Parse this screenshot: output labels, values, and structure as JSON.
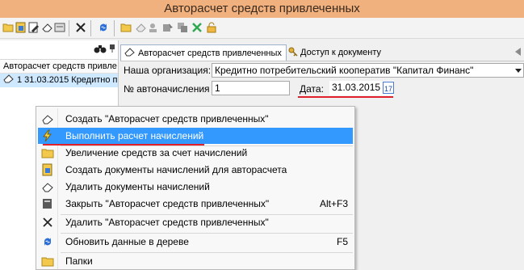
{
  "window": {
    "title": "Авторасчет средств привлеченных"
  },
  "left_panel": {
    "column_header": "Авторасчет средств привле",
    "row_label": "1 31.03.2015 Кредитно п"
  },
  "tabs": [
    {
      "label": "Авторасчет средств привлеченных"
    },
    {
      "label": "Доступ к документу"
    }
  ],
  "form": {
    "org_label": "Наша организация:",
    "org_value": "Кредитно потребительский кооператив \"Капитал Финанс\"",
    "num_label": "№ автоначисления",
    "num_value": "1",
    "date_label": "Дата:",
    "date_value": "31.03.2015",
    "calendar_day": "17"
  },
  "menu": {
    "items": [
      {
        "label": "Создать \"Авторасчет средств привлеченных\"",
        "shortcut": ""
      },
      {
        "label": "Выполнить расчет начислений",
        "shortcut": ""
      },
      {
        "label": "Увеличение средств за счет начислений",
        "shortcut": ""
      },
      {
        "label": "Создать документы начислений для авторасчета",
        "shortcut": ""
      },
      {
        "label": "Удалить документы начислений",
        "shortcut": ""
      },
      {
        "label": "Закрыть \"Авторасчет средств привлеченных\"",
        "shortcut": "Alt+F3"
      },
      {
        "label": "Удалить \"Авторасчет средств привлеченных\"",
        "shortcut": ""
      },
      {
        "label": "Обновить данные в дереве",
        "shortcut": "F5"
      },
      {
        "label": "Папки",
        "shortcut": ""
      }
    ],
    "highlight_color": "#3399ff"
  },
  "colors": {
    "titlebar": "#f1b17f",
    "accent_red": "#e0202a",
    "selection": "#cde8ff"
  },
  "icons": [
    "folder-icon",
    "edit-icon",
    "eraser-icon",
    "delete-icon",
    "refresh-icon",
    "lightning-icon",
    "check-icon",
    "lock-icon",
    "binoculars-icon",
    "key-icon",
    "calendar-icon"
  ]
}
